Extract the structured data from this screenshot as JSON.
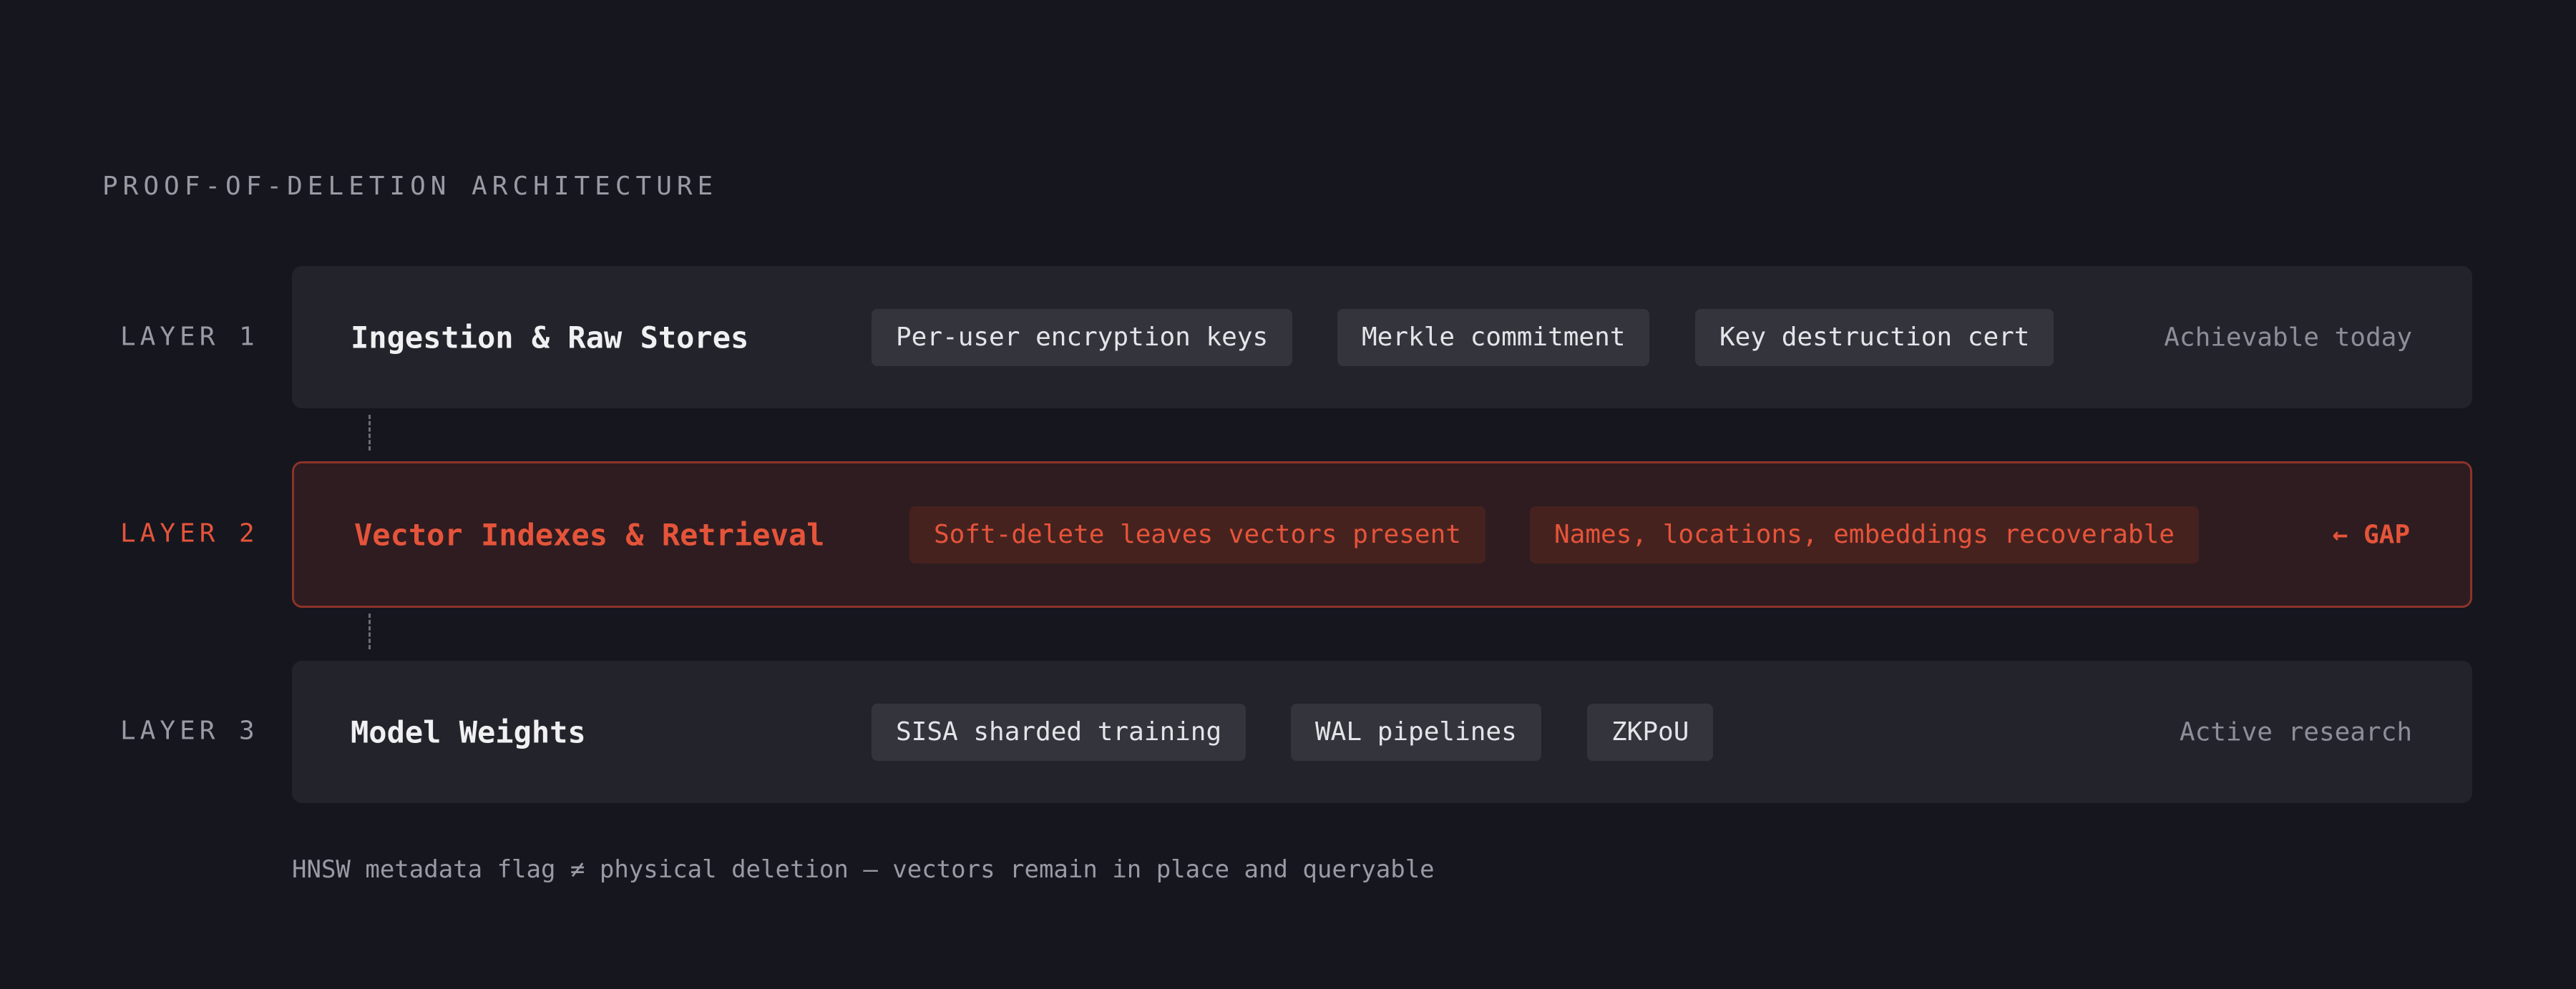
{
  "heading": "PROOF-OF-DELETION ARCHITECTURE",
  "layers": [
    {
      "label": "LAYER 1",
      "title": "Ingestion & Raw Stores",
      "chips": [
        "Per-user encryption keys",
        "Merkle commitment",
        "Key destruction cert"
      ],
      "status": "Achievable today"
    },
    {
      "label": "LAYER 2",
      "title": "Vector Indexes & Retrieval",
      "chips": [
        "Soft-delete leaves vectors present",
        "Names, locations, embeddings recoverable"
      ],
      "status": "← GAP"
    },
    {
      "label": "LAYER 3",
      "title": "Model Weights",
      "chips": [
        "SISA sharded training",
        "WAL pipelines",
        "ZKPoU"
      ],
      "status": "Active research"
    }
  ],
  "footnote": "HNSW metadata flag ≠ physical deletion — vectors remain in place and queryable",
  "colors": {
    "background": "#16161e",
    "band": "#23232b",
    "gap_accent": "#e5543a",
    "gap_band": "#2e1c20",
    "gap_border": "#8c3328"
  }
}
